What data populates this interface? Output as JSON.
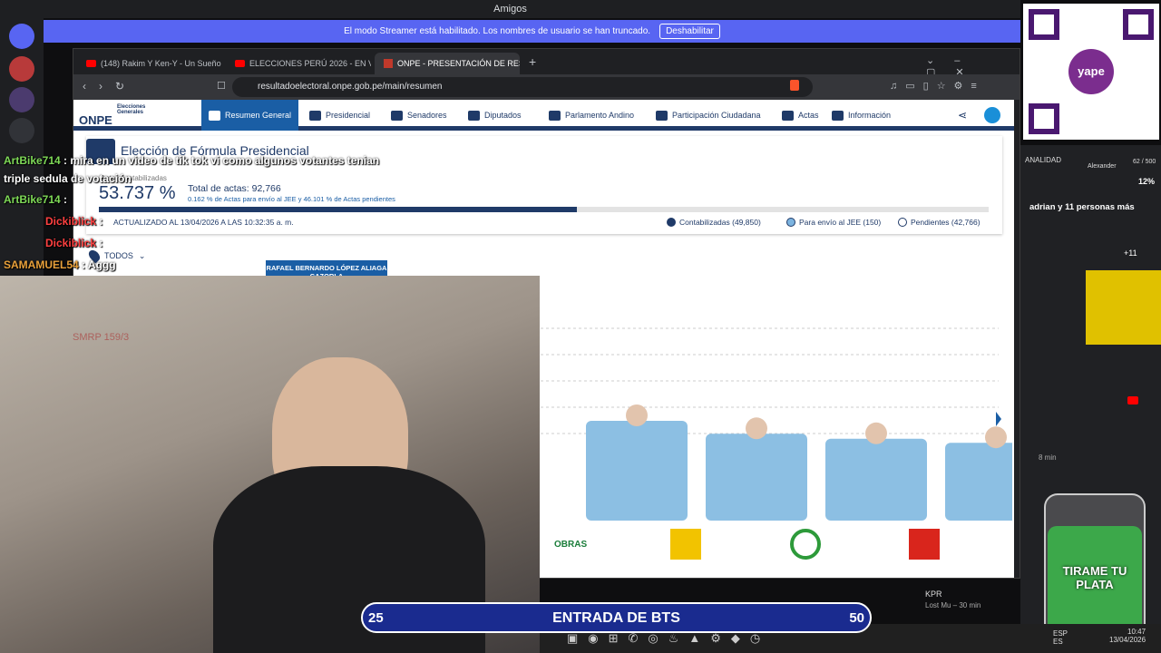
{
  "discord": {
    "title": "Amigos",
    "banner_text": "El modo Streamer está habilitado. Los nombres de usuario se han truncado.",
    "banner_button": "Deshabilitar"
  },
  "browser": {
    "tabs": [
      {
        "label": "(148) Rakim Y Ken-Y - Un Sueño | Ga"
      },
      {
        "label": "ELECCIONES PERÚ 2026 - EN VIVO -"
      },
      {
        "label": "ONPE - PRESENTACIÓN DE RESU"
      }
    ],
    "url": "resultadoelectoral.onpe.gob.pe/main/resumen"
  },
  "onpe": {
    "logo": "ONPE",
    "logo_sub": "Elecciones Generales",
    "nav": [
      {
        "label": "Resumen General"
      },
      {
        "label": "Presidencial"
      },
      {
        "label": "Senadores"
      },
      {
        "label": "Diputados"
      },
      {
        "label": "Parlamento Andino"
      },
      {
        "label": "Participación Ciudadana"
      },
      {
        "label": "Actas"
      },
      {
        "label": "Información"
      }
    ],
    "election_title": "Elección de Fórmula Presidencial",
    "pct_label": "Actas contabilizadas",
    "pct_value": "53.737 %",
    "actas_total": "Total de actas: 92,766",
    "actas_sub": "0.162 % de Actas para envío al JEE y 46.101 % de Actas pendientes",
    "progress_fraction": 0.537,
    "updated": "ACTUALIZADO AL 13/04/2026 A LAS 10:32:35 a. m.",
    "legend": [
      {
        "label": "Contabilizadas (49,850)",
        "color": "#1f3a68"
      },
      {
        "label": "Para envío al JEE (150)",
        "color": "#7db4e0"
      },
      {
        "label": "Pendientes (42,766)",
        "color": "#ffffff"
      }
    ],
    "filter": "TODOS",
    "candidate_tab": "RAFAEL BERNARDO LÓPEZ ALIAGA CAZORLA",
    "party_labels": [
      "OBRAS"
    ]
  },
  "chart_data": {
    "type": "bar",
    "values_relative": [
      1.0,
      0.87,
      0.82,
      0.78
    ],
    "bar_color": "#8cbfe3"
  },
  "chat": [
    {
      "user": "ArtBike714",
      "text": "mira en un video de tik tok vi como algunos votantes tenian",
      "color": "#7ed957"
    },
    {
      "user": "",
      "text": "triple sedula de votación",
      "color": "#ffffff"
    },
    {
      "user": "ArtBike714",
      "text": "",
      "color": "#7ed957"
    },
    {
      "user": "Dickiblick",
      "text": "",
      "color": "#ff4040"
    },
    {
      "user": "Dickiblick",
      "text": "",
      "color": "#ff4040"
    },
    {
      "user": "SAMAMUEL54",
      "text": "Aggg",
      "color": "#e8a03a"
    }
  ],
  "webcam_text": "SMRP 159/3",
  "right": {
    "qr_brand": "yape",
    "overlay_label": "ANALIDAD",
    "overlay_value": "52",
    "viewer_name": "Alexander",
    "viewer_count": "62 / 500",
    "viewer_pct": "12%",
    "notify": "adrian y 11 personas más",
    "plus": "+11",
    "time1": "8 min",
    "kpr_name": "KPR",
    "kpr_sub": "Lost Mu – 30 min",
    "jar_text": "TIRAME TU PLATA"
  },
  "counter": {
    "left": "25",
    "center": "ENTRADA DE BTS",
    "right": "50"
  },
  "taskbar": {
    "lang": "ESP",
    "region": "ES",
    "time": "10:47",
    "date": "13/04/2026"
  }
}
